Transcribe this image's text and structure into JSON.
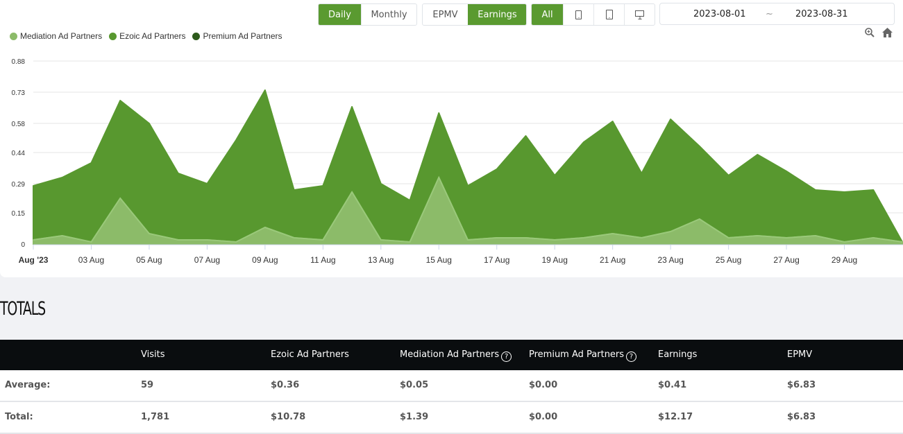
{
  "controls": {
    "period": [
      {
        "label": "Daily",
        "active": true
      },
      {
        "label": "Monthly",
        "active": false
      }
    ],
    "metric": [
      {
        "label": "EPMV",
        "active": false
      },
      {
        "label": "Earnings",
        "active": true
      }
    ],
    "device": [
      {
        "label": "All",
        "active": true
      },
      {
        "icon": "mobile-icon"
      },
      {
        "icon": "tablet-icon"
      },
      {
        "icon": "desktop-icon"
      }
    ],
    "date_start": "2023-08-01",
    "date_separator": "~",
    "date_end": "2023-08-31",
    "tools": [
      "zoom-icon",
      "home-icon"
    ]
  },
  "colors": {
    "mediation": "#8cbb69",
    "ezoic": "#58982f",
    "premium": "#2d5a1b",
    "accent": "#5a9a30"
  },
  "chart_data": {
    "type": "area",
    "stacked": true,
    "legend": [
      "Mediation Ad Partners",
      "Ezoic Ad Partners",
      "Premium Ad Partners"
    ],
    "legend_position": "top-left",
    "x": [
      "Aug 1",
      "Aug 2",
      "Aug 3",
      "Aug 4",
      "Aug 5",
      "Aug 6",
      "Aug 7",
      "Aug 8",
      "Aug 9",
      "Aug 10",
      "Aug 11",
      "Aug 12",
      "Aug 13",
      "Aug 14",
      "Aug 15",
      "Aug 16",
      "Aug 17",
      "Aug 18",
      "Aug 19",
      "Aug 20",
      "Aug 21",
      "Aug 22",
      "Aug 23",
      "Aug 24",
      "Aug 25",
      "Aug 26",
      "Aug 27",
      "Aug 28",
      "Aug 29",
      "Aug 30",
      "Aug 31"
    ],
    "x_tick_labels": [
      "Aug '23",
      "03 Aug",
      "05 Aug",
      "07 Aug",
      "09 Aug",
      "11 Aug",
      "13 Aug",
      "15 Aug",
      "17 Aug",
      "19 Aug",
      "21 Aug",
      "23 Aug",
      "25 Aug",
      "27 Aug",
      "29 Aug"
    ],
    "y_tick_labels": [
      "0",
      "0.15",
      "0.29",
      "0.44",
      "0.58",
      "0.73",
      "0.88"
    ],
    "ylim": [
      0,
      0.88
    ],
    "grid": true,
    "series": [
      {
        "name": "Mediation Ad Partners",
        "values": [
          0.02,
          0.04,
          0.01,
          0.22,
          0.05,
          0.02,
          0.02,
          0.01,
          0.08,
          0.03,
          0.02,
          0.25,
          0.02,
          0.01,
          0.32,
          0.02,
          0.03,
          0.03,
          0.02,
          0.03,
          0.05,
          0.03,
          0.06,
          0.12,
          0.03,
          0.04,
          0.03,
          0.04,
          0.01,
          0.03,
          0.01
        ]
      },
      {
        "name": "Ezoic Ad Partners",
        "values": [
          0.26,
          0.28,
          0.38,
          0.47,
          0.53,
          0.32,
          0.27,
          0.49,
          0.66,
          0.23,
          0.26,
          0.41,
          0.27,
          0.2,
          0.31,
          0.26,
          0.33,
          0.49,
          0.31,
          0.46,
          0.54,
          0.31,
          0.54,
          0.35,
          0.3,
          0.39,
          0.32,
          0.22,
          0.24,
          0.23,
          0.0
        ]
      },
      {
        "name": "Premium Ad Partners",
        "values": [
          0,
          0,
          0,
          0,
          0,
          0,
          0,
          0,
          0,
          0,
          0,
          0,
          0,
          0,
          0,
          0,
          0,
          0,
          0,
          0,
          0,
          0,
          0,
          0,
          0,
          0,
          0,
          0,
          0,
          0,
          0
        ]
      }
    ]
  },
  "totals": {
    "title": "TOTALS",
    "columns": [
      "",
      "Visits",
      "Ezoic Ad Partners",
      "Mediation Ad Partners",
      "Premium Ad Partners",
      "Earnings",
      "EPMV"
    ],
    "help_columns": [
      3,
      4
    ],
    "rows": [
      {
        "label": "Average:",
        "values": [
          "59",
          "$0.36",
          "$0.05",
          "$0.00",
          "$0.41",
          "$6.83"
        ]
      },
      {
        "label": "Total:",
        "values": [
          "1,781",
          "$10.78",
          "$1.39",
          "$0.00",
          "$12.17",
          "$6.83"
        ]
      }
    ]
  }
}
